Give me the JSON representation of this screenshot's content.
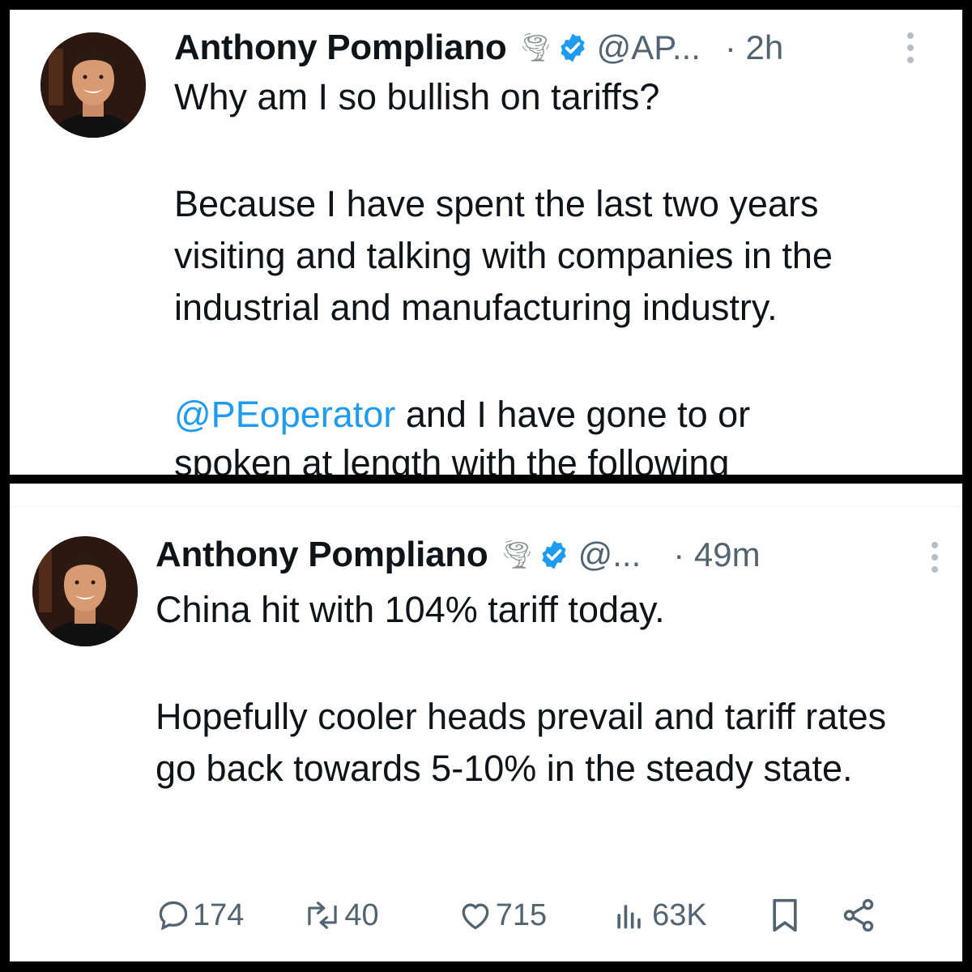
{
  "tweets": [
    {
      "author": "Anthony Pompliano",
      "handle": "@AP...",
      "time": "· 2h",
      "text": {
        "line1": "Why am I so bullish on tariffs?",
        "para2": "Because I have spent the last two years visiting and talking with companies in the industrial and manufacturing industry.",
        "mention": "@PEoperator",
        "para3_rest": " and I have gone to or",
        "para3_cut": "spoken at length with the following"
      }
    },
    {
      "author": "Anthony Pompliano",
      "handle": "@...",
      "time": "· 49m",
      "text": {
        "line1": "China hit with 104% tariff today.",
        "para2": "Hopefully cooler heads prevail and tariff rates go back towards 5-10% in the steady state."
      },
      "stats": {
        "replies": "174",
        "reposts": "40",
        "likes": "715",
        "views": "63K"
      }
    }
  ],
  "icons": {
    "emoji": "tornado-icon",
    "verified": "verified-badge-icon",
    "more": "more-icon",
    "reply": "reply-icon",
    "repost": "repost-icon",
    "like": "like-icon",
    "views": "views-icon",
    "bookmark": "bookmark-icon",
    "share": "share-icon"
  },
  "colors": {
    "verified": "#1d9bf0",
    "mention": "#1d9bf0",
    "secondary_text": "#536471",
    "frame": "#000000"
  }
}
